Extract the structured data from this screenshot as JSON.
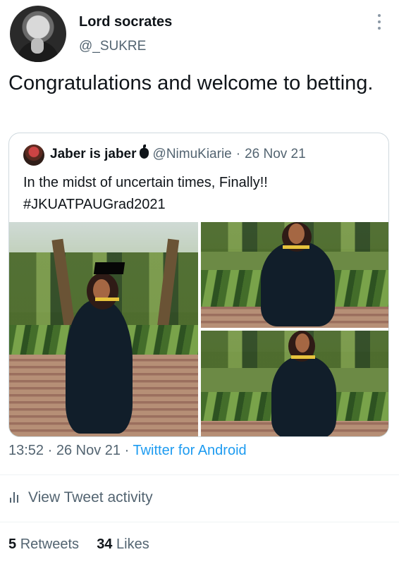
{
  "author": {
    "name": "Lord socrates",
    "handle": "@_SUKRE",
    "avatar_icon": "profile-avatar-icon"
  },
  "tweet": {
    "text": "Congratulations and welcome to betting."
  },
  "quoted_tweet": {
    "name": "Jaber is jaber",
    "handle": "@NimuKiarie",
    "date": "26 Nov 21",
    "text_line_1": "In the midst of uncertain times, Finally!!",
    "text_line_2": "#JKUATPAUGrad2021"
  },
  "metadata": {
    "time": "13:52",
    "date": "26 Nov 21",
    "source": "Twitter for Android",
    "separator": "·"
  },
  "activity": {
    "label": "View Tweet activity",
    "icon": "analytics-bar-icon"
  },
  "stats": {
    "retweets_count": "5",
    "retweets_label": "Retweets",
    "likes_count": "34",
    "likes_label": "Likes"
  },
  "colors": {
    "link": "#1d9bf0",
    "secondary_text": "#536471",
    "primary_text": "#0f1419"
  }
}
